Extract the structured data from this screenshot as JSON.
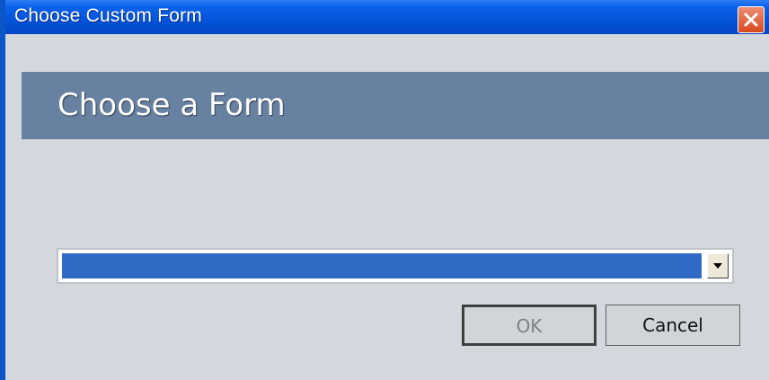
{
  "window": {
    "title": "Choose Custom Form"
  },
  "header": {
    "heading": "Choose a Form"
  },
  "form_select": {
    "selected_value": ""
  },
  "buttons": {
    "ok_label": "OK",
    "cancel_label": "Cancel"
  },
  "icons": {
    "close": "close-icon",
    "dropdown": "chevron-down-icon"
  },
  "colors": {
    "titlebar": "#0553d8",
    "close_button": "#d8491e",
    "header_band": "#6781a0",
    "selection_highlight": "#316ac5",
    "window_background": "#d4d8dc"
  }
}
